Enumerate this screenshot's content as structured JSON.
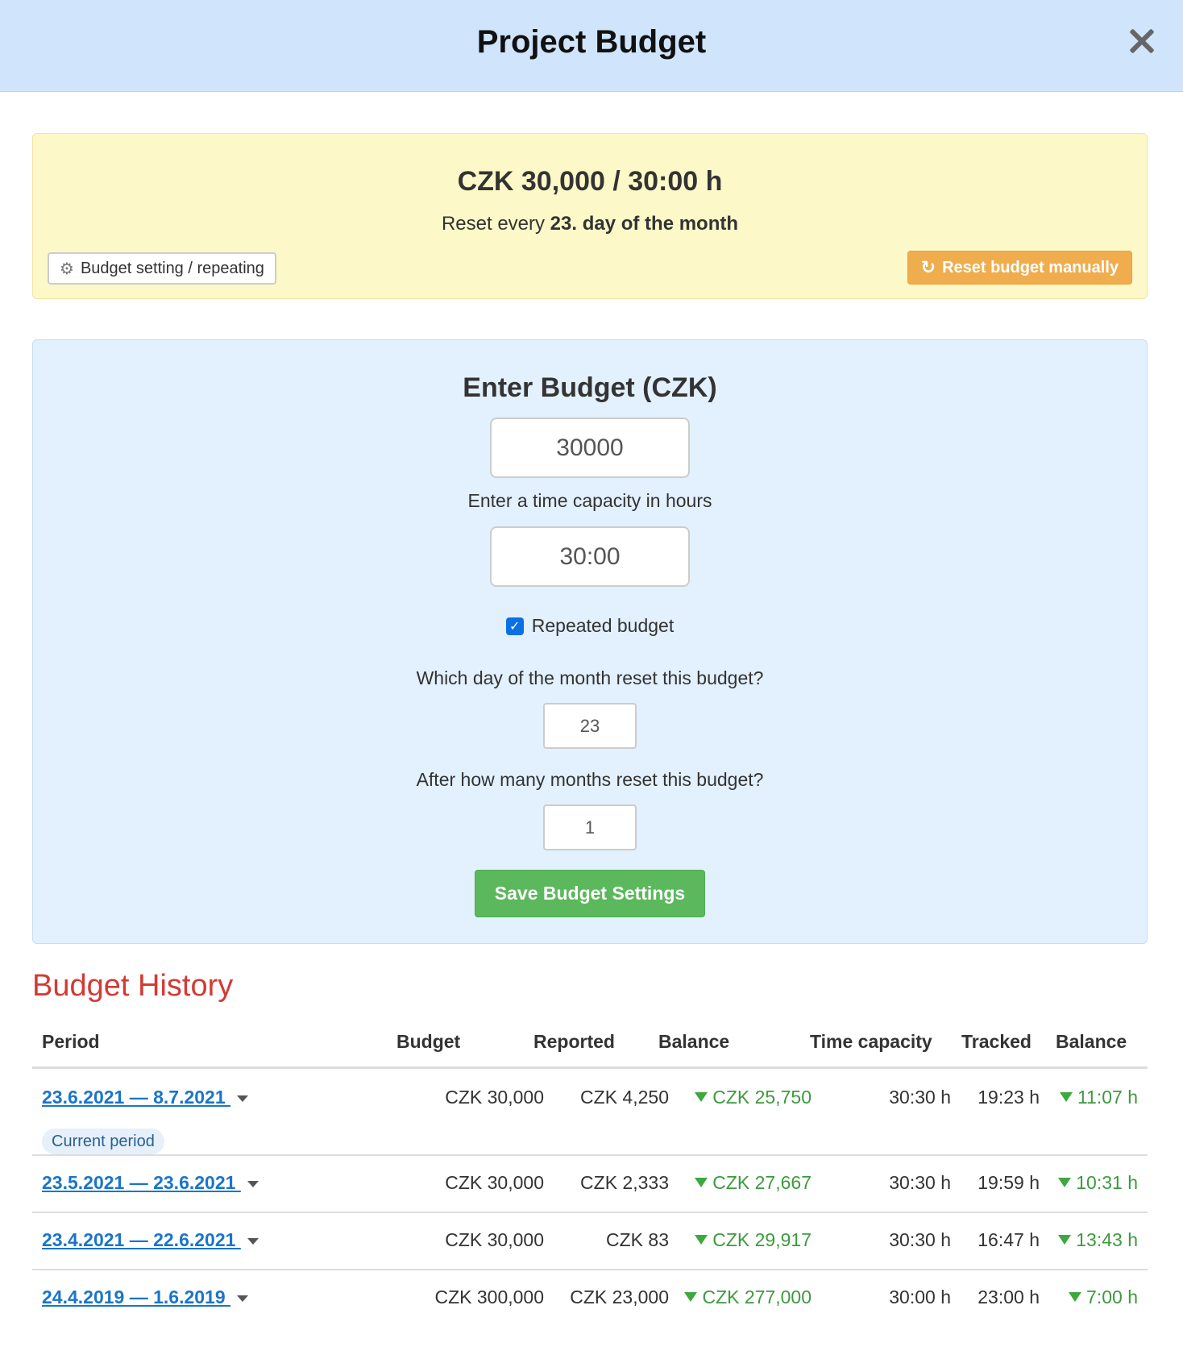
{
  "header": {
    "title": "Project Budget",
    "close_icon": "close-icon"
  },
  "summary": {
    "amount": "CZK 30,000 / 30:00 h",
    "reset_prefix": "Reset every ",
    "reset_bold": "23. day of the month",
    "setting_button": "Budget setting / repeating",
    "setting_icon": "gear-icon",
    "reset_button": "Reset budget manually",
    "reset_icon": "refresh-icon",
    "reset_button_color": "#f0ad4e",
    "background_color": "#fcf8c8"
  },
  "form": {
    "title": "Enter Budget (CZK)",
    "budget_value": "30000",
    "time_label": "Enter a time capacity in hours",
    "time_value": "30:00",
    "repeated_label": "Repeated budget",
    "repeated_checked": true,
    "day_label": "Which day of the month reset this budget?",
    "day_value": "23",
    "months_label": "After how many months reset this budget?",
    "months_value": "1",
    "save_button": "Save Budget Settings",
    "save_button_color": "#5cb85c"
  },
  "history": {
    "title": "Budget History",
    "title_color": "#d33a35",
    "columns": [
      "Period",
      "Budget",
      "Reported",
      "Balance",
      "Time capacity",
      "Tracked",
      "Balance"
    ],
    "rows": [
      {
        "period": "23.6.2021 — 8.7.2021 ",
        "budget": "CZK 30,000",
        "reported": "CZK 4,250",
        "balance": "CZK 25,750",
        "time_capacity": "30:30 h",
        "tracked": "19:23 h",
        "time_balance": "11:07 h",
        "badge": "Current period"
      },
      {
        "period": "23.5.2021 — 23.6.2021 ",
        "budget": "CZK 30,000",
        "reported": "CZK 2,333",
        "balance": "CZK 27,667",
        "time_capacity": "30:30 h",
        "tracked": "19:59 h",
        "time_balance": "10:31 h"
      },
      {
        "period": "23.4.2021 — 22.6.2021 ",
        "budget": "CZK 30,000",
        "reported": "CZK 83",
        "balance": "CZK 29,917",
        "time_capacity": "30:30 h",
        "tracked": "16:47 h",
        "time_balance": "13:43 h"
      },
      {
        "period": "24.4.2019 — 1.6.2019 ",
        "budget": "CZK 300,000",
        "reported": "CZK 23,000",
        "balance": "CZK 277,000",
        "time_capacity": "30:00 h",
        "tracked": "23:00 h",
        "time_balance": "7:00 h"
      }
    ],
    "positive_color": "#3d9a3d"
  }
}
